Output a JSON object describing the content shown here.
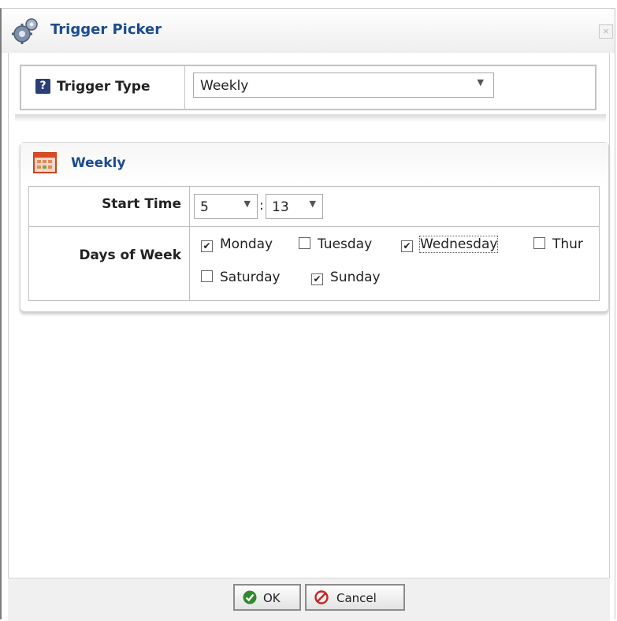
{
  "window": {
    "title": "Trigger Picker",
    "close_glyph": "×"
  },
  "trigger_type": {
    "label": "Trigger Type",
    "help_glyph": "?",
    "selected": "Weekly",
    "icon": "help-icon"
  },
  "weekly_panel": {
    "title": "Weekly",
    "start_time": {
      "label": "Start Time",
      "hour": "5",
      "separator": ":",
      "minute": "13"
    },
    "days_of_week": {
      "label": "Days of Week",
      "days": [
        {
          "label": "Monday",
          "checked": true
        },
        {
          "label": "Tuesday",
          "checked": false
        },
        {
          "label": "Wednesday",
          "checked": true,
          "focused": true
        },
        {
          "label": "Thur",
          "checked": false
        },
        {
          "label": "Saturday",
          "checked": false
        },
        {
          "label": "Sunday",
          "checked": true
        }
      ]
    }
  },
  "footer": {
    "ok_label": "OK",
    "cancel_label": "Cancel"
  },
  "colors": {
    "title_blue": "#1b4c8e",
    "ok_green": "#2f8a2f",
    "cancel_red": "#cc2222"
  }
}
